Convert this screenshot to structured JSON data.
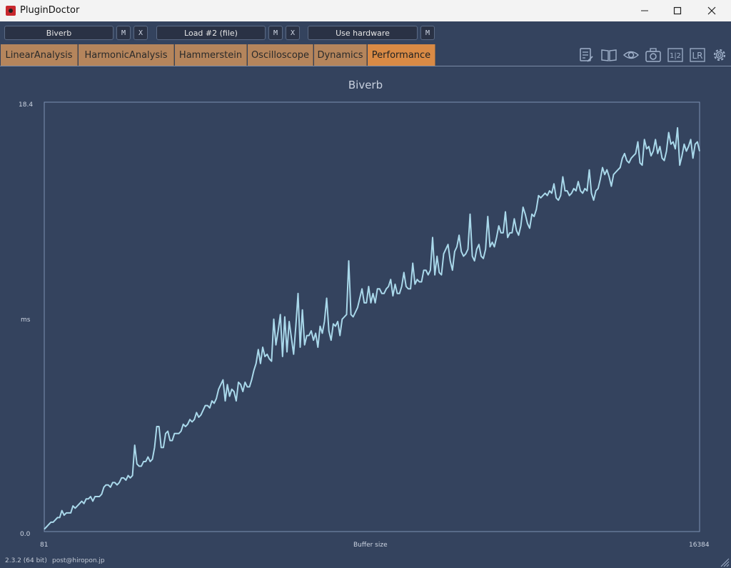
{
  "window": {
    "title": "PluginDoctor",
    "minimize": "—",
    "maximize": "☐",
    "close": "✕"
  },
  "toolbar": {
    "plugin_a": "Biverb",
    "plugin_a_m": "M",
    "plugin_a_x": "X",
    "plugin_b": "Load #2 (file)",
    "plugin_b_m": "M",
    "plugin_b_x": "X",
    "hardware": "Use hardware",
    "hardware_m": "M"
  },
  "tabs": [
    "LinearAnalysis",
    "HarmonicAnalysis",
    "Hammerstein",
    "Oscilloscope",
    "Dynamics",
    "Performance"
  ],
  "active_tab": "Performance",
  "icons": [
    "notes-icon",
    "book-icon",
    "eye-icon",
    "camera-icon",
    "channel-1-2-icon",
    "lr-icon",
    "gear-icon"
  ],
  "icon_text": {
    "channel": "1|2",
    "lr": "LR"
  },
  "chart_data": {
    "type": "line",
    "title": "Biverb",
    "xlabel": "Buffer size",
    "ylabel": "ms",
    "x_ticks": [
      "81",
      "16384"
    ],
    "y_ticks": [
      "0.0",
      "18.4"
    ],
    "xlim": [
      81,
      16384
    ],
    "ylim": [
      0.0,
      18.4
    ],
    "color": "#a9d8ea",
    "series": [
      {
        "values": [
          0.1,
          0.2,
          0.3,
          0.4,
          0.4,
          0.5,
          0.6,
          0.6,
          0.9,
          0.7,
          0.8,
          0.8,
          0.8,
          1.1,
          1.0,
          1.1,
          1.2,
          1.3,
          1.2,
          1.4,
          1.4,
          1.5,
          1.3,
          1.5,
          1.5,
          1.5,
          1.6,
          1.9,
          2.0,
          2.0,
          1.9,
          2.1,
          2.1,
          2.0,
          2.1,
          2.3,
          2.3,
          2.2,
          2.4,
          2.3,
          2.4,
          3.7,
          2.9,
          2.8,
          2.8,
          3.0,
          3.0,
          3.2,
          3.0,
          3.1,
          3.6,
          4.5,
          4.5,
          3.6,
          3.6,
          4.2,
          4.3,
          3.9,
          3.9,
          4.2,
          4.2,
          4.2,
          4.3,
          4.6,
          4.5,
          4.6,
          4.8,
          4.7,
          4.8,
          5.1,
          4.9,
          5.0,
          5.2,
          5.4,
          5.4,
          5.3,
          5.6,
          5.5,
          5.7,
          6.1,
          6.3,
          6.5,
          5.6,
          6.3,
          5.8,
          6.1,
          6.0,
          5.6,
          6.4,
          6.3,
          6.0,
          6.4,
          6.2,
          6.2,
          6.5,
          6.9,
          7.2,
          7.8,
          7.2,
          7.9,
          7.5,
          7.6,
          7.4,
          7.3,
          9.1,
          8.0,
          8.6,
          9.3,
          7.5,
          9.2,
          7.7,
          9.0,
          8.3,
          7.6,
          8.8,
          10.2,
          7.9,
          9.5,
          8.0,
          8.4,
          8.4,
          8.6,
          8.2,
          8.5,
          7.9,
          8.8,
          8.5,
          9.0,
          10.0,
          8.6,
          8.2,
          8.9,
          8.8,
          9.0,
          8.4,
          9.1,
          9.2,
          9.3,
          11.6,
          9.3,
          9.2,
          9.4,
          9.6,
          10.0,
          10.4,
          9.8,
          9.8,
          10.5,
          9.8,
          10.2,
          9.8,
          10.4,
          10.4,
          10.2,
          10.2,
          10.4,
          10.5,
          10.8,
          10.1,
          10.6,
          10.2,
          10.2,
          10.5,
          11.1,
          10.5,
          10.4,
          10.4,
          11.5,
          10.6,
          10.8,
          10.7,
          10.7,
          11.2,
          11.2,
          11.0,
          11.2,
          12.6,
          11.0,
          11.8,
          11.1,
          11.0,
          11.9,
          12.1,
          12.3,
          11.6,
          11.2,
          12.0,
          12.2,
          12.7,
          12.0,
          11.8,
          11.9,
          12.1,
          13.6,
          11.8,
          11.6,
          12.1,
          12.3,
          11.8,
          11.7,
          12.1,
          13.5,
          12.2,
          12.4,
          12.2,
          12.6,
          13.1,
          12.8,
          12.8,
          13.7,
          12.6,
          12.8,
          12.8,
          13.4,
          12.9,
          12.7,
          13.1,
          13.9,
          13.6,
          13.2,
          13.0,
          13.6,
          13.5,
          13.8,
          14.4,
          14.3,
          14.4,
          14.5,
          14.4,
          14.6,
          14.5,
          14.9,
          14.3,
          14.2,
          14.4,
          15.2,
          14.6,
          14.6,
          14.4,
          14.5,
          14.7,
          14.6,
          15.0,
          14.6,
          14.5,
          14.7,
          14.6,
          15.5,
          14.5,
          14.2,
          14.6,
          14.7,
          15.1,
          15.6,
          15.3,
          15.5,
          15.2,
          14.8,
          15.3,
          15.4,
          15.5,
          15.6,
          16.0,
          16.2,
          15.9,
          15.8,
          16.0,
          16.1,
          16.2,
          16.7,
          15.8,
          15.7,
          16.8,
          16.4,
          16.5,
          16.1,
          16.3,
          16.8,
          16.2,
          16.5,
          16.0,
          15.9,
          16.3,
          17.1,
          16.6,
          16.7,
          16.4,
          17.3,
          15.7,
          16.1,
          16.6,
          16.3,
          16.5,
          16.8,
          16.0,
          16.6,
          16.7,
          16.3
        ]
      }
    ]
  },
  "footer": {
    "version": "2.3.2 (64 bit)",
    "email": "post@hiropon.jp"
  }
}
